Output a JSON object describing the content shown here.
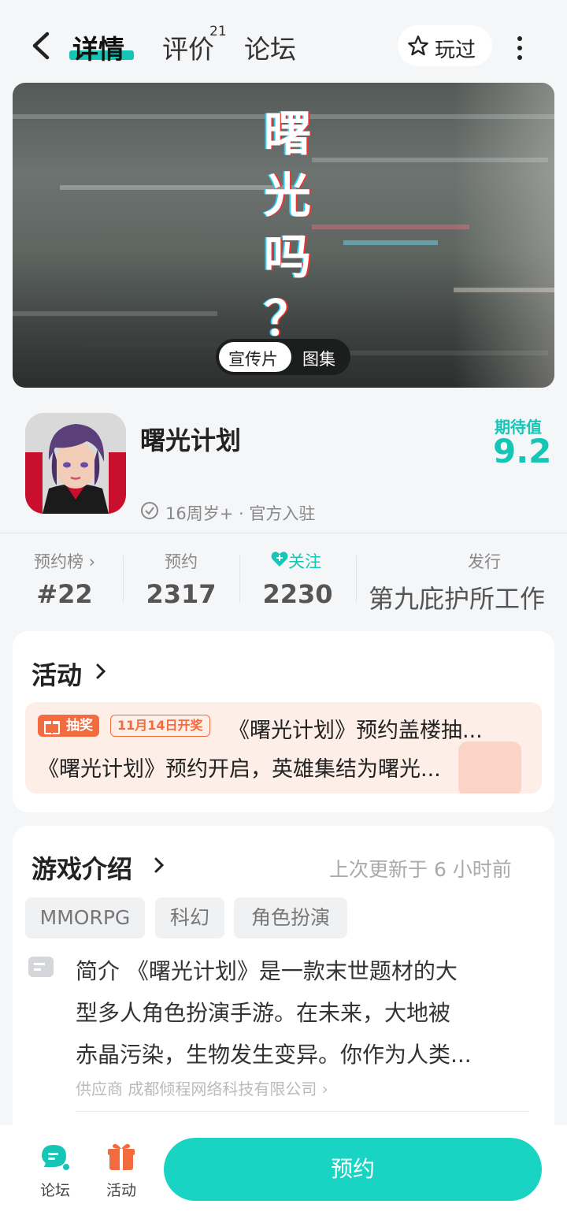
{
  "header": {
    "tabs": [
      {
        "label": "详情"
      },
      {
        "label": "评价"
      },
      {
        "label": "论坛"
      }
    ],
    "review_count": "21",
    "played_label": "玩过"
  },
  "banner": {
    "overlay_chars": [
      "曙",
      "光",
      "吗",
      "？"
    ],
    "media_tabs": [
      "宣传片",
      "图集"
    ]
  },
  "game": {
    "name": "曙光计划",
    "meta": "16周岁+ · 官方入驻",
    "expectation_label": "期待值",
    "expectation_value": "9.2"
  },
  "stats": [
    {
      "label": "预约榜 ›",
      "value": "#22"
    },
    {
      "label": "预约",
      "value": "2317"
    },
    {
      "label": "关注",
      "value": "2230"
    },
    {
      "label": "发行",
      "value": "第九庇护所工作"
    }
  ],
  "activity": {
    "title": "活动",
    "lottery_badge": "抽奖",
    "date_badge": "11月14日开奖",
    "line1": "《曙光计划》预约盖楼抽...",
    "line2": "《曙光计划》预约开启，英雄集结为曙光..."
  },
  "intro": {
    "title": "游戏介绍",
    "updated": "上次更新于 6 小时前",
    "tags": [
      "MMORPG",
      "科幻",
      "角色扮演"
    ],
    "lines": [
      "简介 《曙光计划》是一款末世题材的大",
      "型多人角色扮演手游。在未来，大地被",
      "赤晶污染，生物发生变异。你作为人类..."
    ],
    "supplier": "供应商 成都倾程网络科技有限公司 ›"
  },
  "bottom_bar": {
    "forum_label": "论坛",
    "activity_label": "活动",
    "reserve_label": "预约"
  },
  "colors": {
    "accent": "#15c5b6",
    "button": "#19d4c3",
    "orange": "#f36c3f"
  }
}
